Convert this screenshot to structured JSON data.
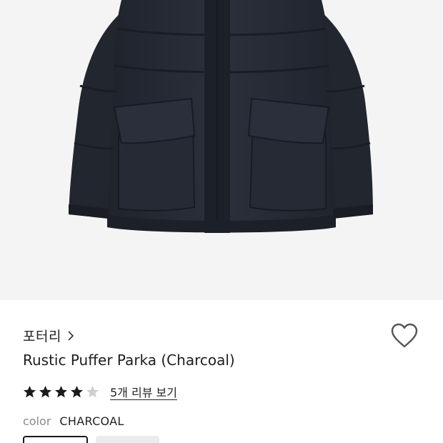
{
  "product": {
    "image_alt": "Rustic Puffer Parka in charcoal",
    "brand": "포터리",
    "name": "Rustic Puffer Parka (Charcoal)",
    "rating": {
      "filled": 4,
      "total": 5
    },
    "review_link": "5개 리뷰 보기",
    "color_label": "color",
    "color_value": "CHARCOAL",
    "swatches": [
      {
        "state": "selected"
      },
      {
        "state": "unselected"
      }
    ]
  },
  "icons": {
    "brand_chevron": "chevron-right-icon",
    "wishlist": "heart-outline-icon",
    "star": "star-icon"
  },
  "colors": {
    "jacket": "#262b36",
    "background": "#f4f4f4",
    "star_filled": "#1a1a1a",
    "star_empty": "#cfcfcf"
  }
}
